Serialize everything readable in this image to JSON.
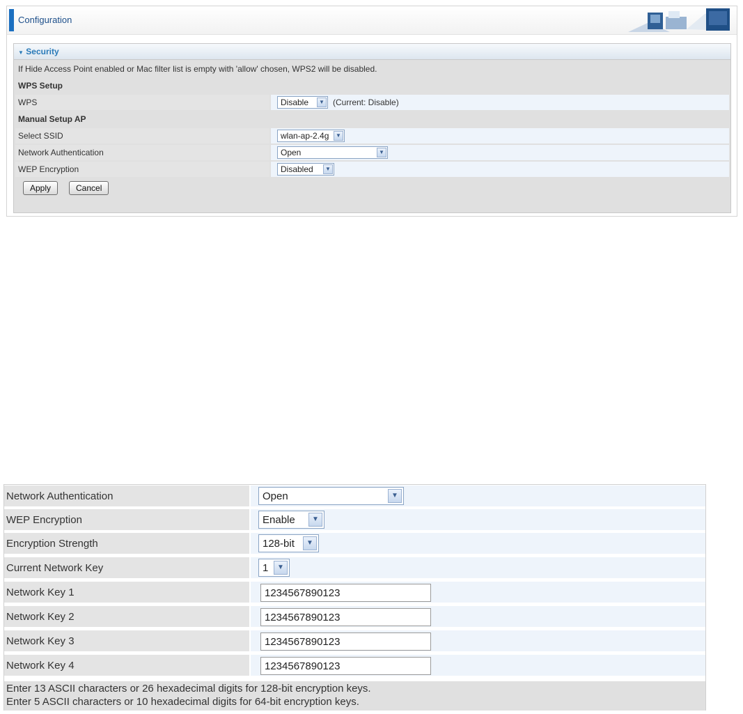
{
  "header": {
    "title": "Configuration"
  },
  "security": {
    "title": "Security",
    "note": "If Hide Access Point enabled or Mac filter list is empty with 'allow' chosen, WPS2 will be disabled.",
    "wps_setup": {
      "heading": "WPS Setup",
      "wps_label": "WPS",
      "wps_value": "Disable",
      "wps_current": "(Current: Disable)"
    },
    "manual_setup": {
      "heading": "Manual Setup AP",
      "ssid_label": "Select SSID",
      "ssid_value": "wlan-ap-2.4g",
      "auth_label": "Network Authentication",
      "auth_value": "Open",
      "wep_label": "WEP Encryption",
      "wep_value": "Disabled"
    },
    "buttons": {
      "apply": "Apply",
      "cancel": "Cancel"
    }
  },
  "wep_detail": {
    "auth_label": "Network Authentication",
    "auth_value": "Open",
    "wep_label": "WEP Encryption",
    "wep_value": "Enable",
    "strength_label": "Encryption Strength",
    "strength_value": "128-bit",
    "current_key_label": "Current Network Key",
    "current_key_value": "1",
    "keys": [
      {
        "label": "Network Key 1",
        "value": "1234567890123"
      },
      {
        "label": "Network Key 2",
        "value": "1234567890123"
      },
      {
        "label": "Network Key 3",
        "value": "1234567890123"
      },
      {
        "label": "Network Key 4",
        "value": "1234567890123"
      }
    ],
    "hint_line1": "Enter 13 ASCII characters or 26 hexadecimal digits for 128-bit encryption keys.",
    "hint_line2": "Enter 5 ASCII characters or 10 hexadecimal digits for 64-bit encryption keys."
  },
  "colors": {
    "accent": "#1b6fc0",
    "section_title": "#2a7ab8",
    "label_bg": "#e4e4e4",
    "value_bg": "#eef4fb"
  },
  "icons": [
    "chevron-down-icon",
    "triangle-down-icon",
    "router-banner-graphic"
  ]
}
